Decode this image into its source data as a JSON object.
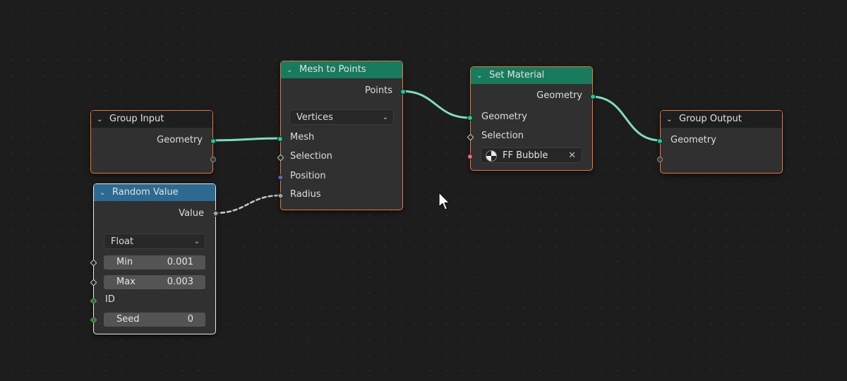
{
  "nodes": {
    "group_input": {
      "title": "Group Input",
      "outputs": [
        "Geometry"
      ]
    },
    "random_value": {
      "title": "Random Value",
      "output": "Value",
      "data_type": "Float",
      "fields": {
        "min": {
          "label": "Min",
          "value": "0.001"
        },
        "max": {
          "label": "Max",
          "value": "0.003"
        },
        "id": {
          "label": "ID"
        },
        "seed": {
          "label": "Seed",
          "value": "0"
        }
      }
    },
    "mesh_to_points": {
      "title": "Mesh to Points",
      "output": "Points",
      "mode": "Vertices",
      "inputs": [
        "Mesh",
        "Selection",
        "Position",
        "Radius"
      ]
    },
    "set_material": {
      "title": "Set Material",
      "output": "Geometry",
      "inputs": [
        "Geometry",
        "Selection"
      ],
      "material": "FF Bubble"
    },
    "group_output": {
      "title": "Group Output",
      "inputs": [
        "Geometry"
      ]
    }
  },
  "colors": {
    "background": "#1d1d1d",
    "node_body": "#303030",
    "selected_border": "#e8772d",
    "active_border": "#e9e9e9",
    "header_green": "#197b5e",
    "header_blue": "#2c6a91",
    "geometry_socket": "#1ec595",
    "geometry_link": "#7fdcc0",
    "float_socket": "#a5a5a5",
    "vector_socket": "#6363c7",
    "material_socket": "#e86a75"
  },
  "icons": {
    "collapse": "chevron-down-icon",
    "material": "material-sphere-icon",
    "clear": "close-icon",
    "cursor": "mouse-pointer-icon"
  }
}
